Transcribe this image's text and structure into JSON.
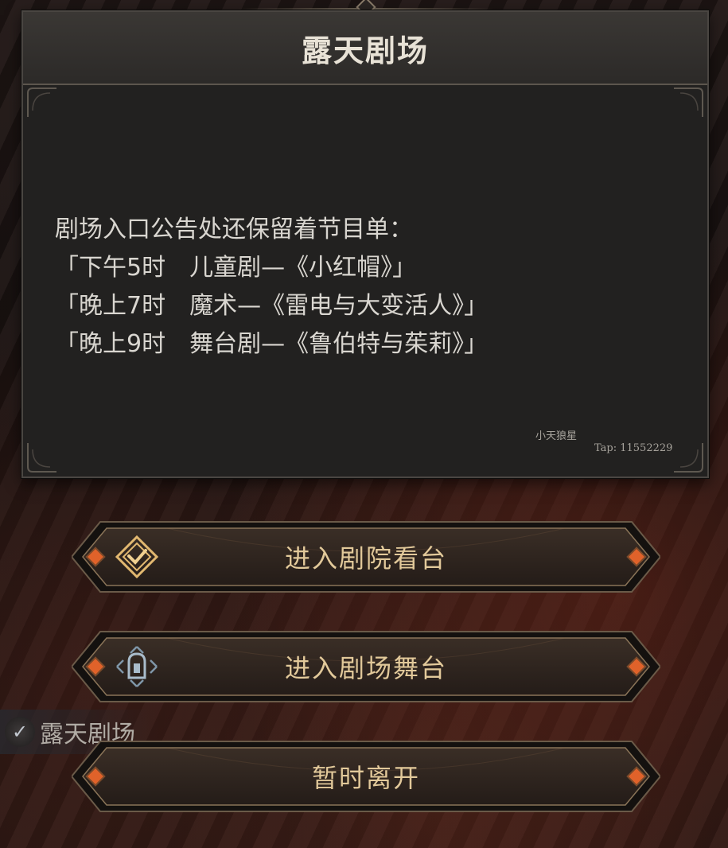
{
  "dialog": {
    "title": "露天剧场",
    "lines": [
      "剧场入口公告处还保留着节目单：",
      "「下午5时　儿童剧—《小红帽》」",
      "「晚上7时　魔术—《雷电与大变活人》」",
      "「晚上9时　舞台剧—《鲁伯特与茱莉》」"
    ],
    "watermark_name": "小天狼星",
    "watermark_tap": "Tap: 11552229"
  },
  "background_label": {
    "text": "露天剧场"
  },
  "buttons": [
    {
      "label": "进入剧院看台",
      "icon": "shield-check-icon"
    },
    {
      "label": "进入剧场舞台",
      "icon": "door-icon"
    },
    {
      "label": "暂时离开",
      "icon": ""
    }
  ],
  "colors": {
    "button_text": "#e2c99a",
    "gem_orange": "#e0622a",
    "panel_bg": "#222120"
  }
}
